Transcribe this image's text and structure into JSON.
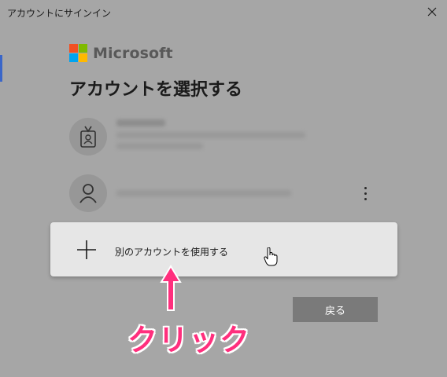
{
  "window": {
    "title": "アカウントにサインイン"
  },
  "logo": {
    "text": "Microsoft",
    "colors": [
      "#f25022",
      "#7fba00",
      "#00a4ef",
      "#ffb900"
    ]
  },
  "heading": "アカウントを選択する",
  "accounts": [
    {
      "icon": "badge-user-icon",
      "state": "blurred"
    },
    {
      "icon": "person-icon",
      "state": "blurred"
    }
  ],
  "add_account": {
    "label": "別のアカウントを使用する"
  },
  "back_button": {
    "label": "戻る"
  },
  "annotation": {
    "text": "クリック",
    "color": "#ff2f7d"
  }
}
